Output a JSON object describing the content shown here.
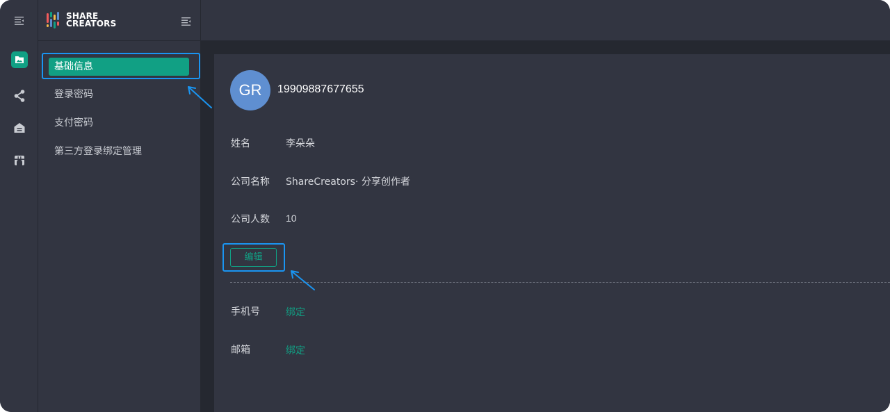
{
  "rail": {
    "items": [
      {
        "icon": "menu-collapse-icon"
      },
      {
        "icon": "folder-icon",
        "active": true
      },
      {
        "icon": "share-icon"
      },
      {
        "icon": "home-icon"
      },
      {
        "icon": "store-icon"
      }
    ]
  },
  "brand": {
    "line1": "SHARE",
    "line2": "CREATORS"
  },
  "sidebar": {
    "items": [
      {
        "label": "基础信息",
        "active": true
      },
      {
        "label": "登录密码"
      },
      {
        "label": "支付密码"
      },
      {
        "label": "第三方登录绑定管理"
      }
    ]
  },
  "profile": {
    "avatar_initials": "GR",
    "account": "19909887677655",
    "fields": [
      {
        "label": "姓名",
        "value": "李朵朵"
      },
      {
        "label": "公司名称",
        "value": "ShareCreators· 分享创作者"
      },
      {
        "label": "公司人数",
        "value": "10"
      }
    ],
    "edit_label": "编辑",
    "bindings": [
      {
        "label": "手机号",
        "action": "绑定"
      },
      {
        "label": "邮箱",
        "action": "绑定"
      }
    ]
  },
  "colors": {
    "accent": "#11a084",
    "highlight": "#1a95f2",
    "panel": "#323541",
    "background": "#252830",
    "avatar": "#5f8fd1"
  }
}
